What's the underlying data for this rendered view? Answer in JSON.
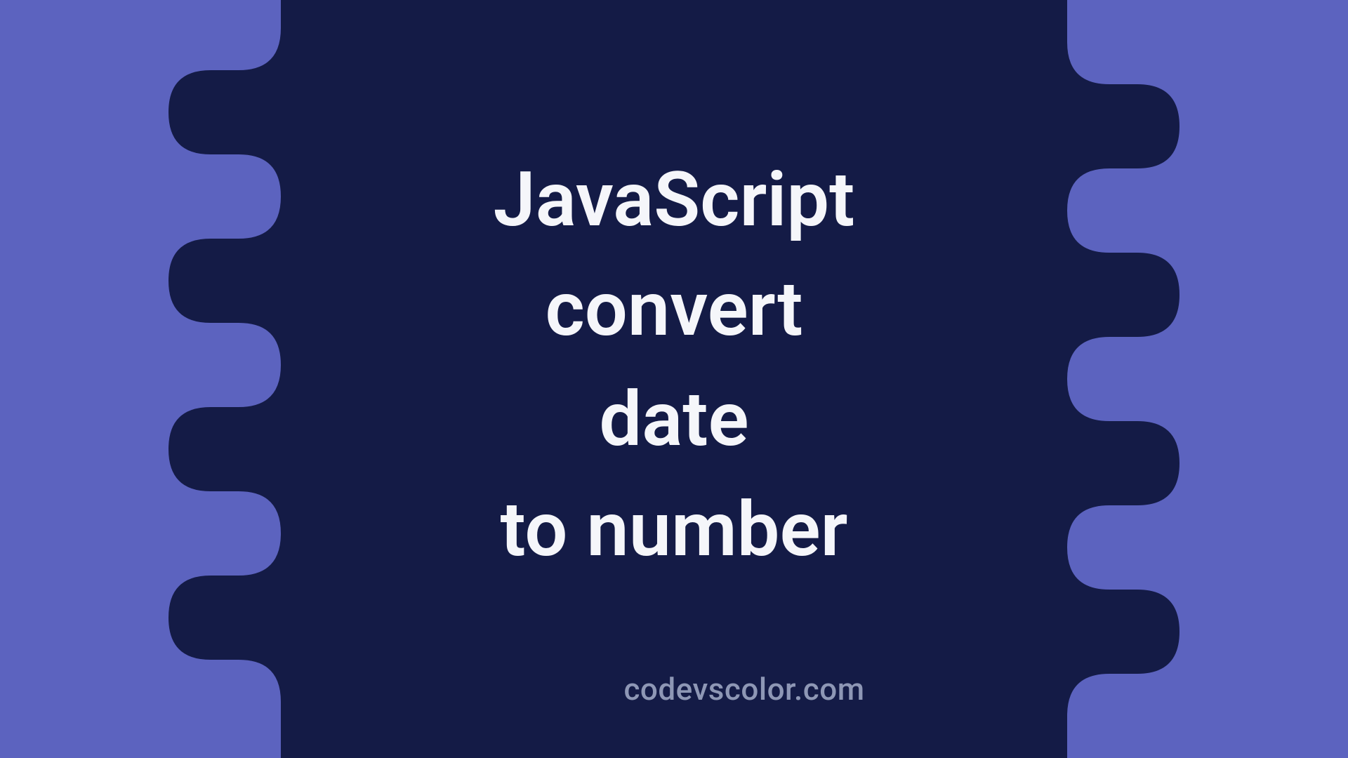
{
  "title_lines": [
    "JavaScript",
    "convert",
    "date",
    "to number"
  ],
  "attribution": "codevscolor.com",
  "colors": {
    "background": "#5c63bf",
    "blob": "#141b46",
    "text": "#f5f6fa",
    "attribution": "#8e97b5"
  }
}
